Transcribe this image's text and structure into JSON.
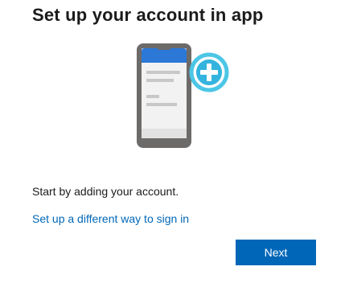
{
  "header": {
    "title": "Set up your account in app"
  },
  "illustration": {
    "icon": "phone-with-plus-icon",
    "colors": {
      "phone_frame": "#6d6a6a",
      "screen_header": "#2b78d6",
      "screen_body": "#f2f2f2",
      "lines": "#c8c8c8",
      "plus_ring": "#4cc6e6",
      "plus_fill": "#1aa3d6"
    }
  },
  "main": {
    "instruction": "Start by adding your account.",
    "alt_link": "Set up a different way to sign in"
  },
  "actions": {
    "next_label": "Next",
    "accent_color": "#0067b8"
  }
}
